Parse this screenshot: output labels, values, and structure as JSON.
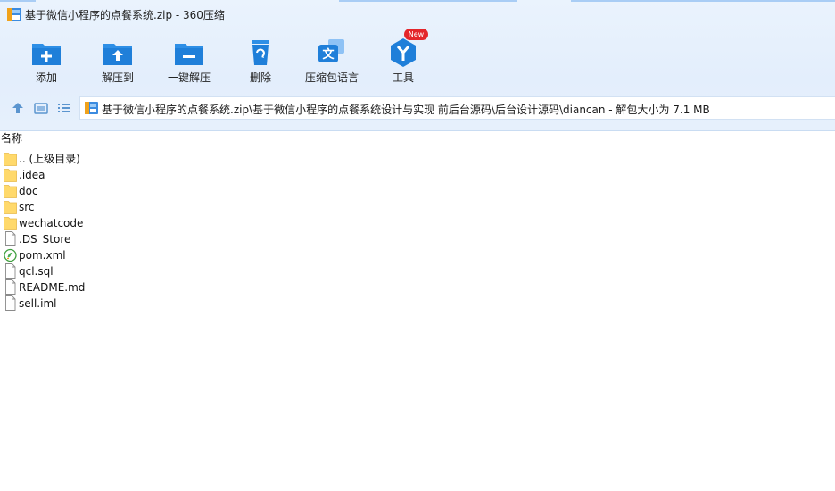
{
  "window": {
    "title": "基于微信小程序的点餐系统.zip - 360压缩"
  },
  "toolbar": {
    "items": [
      {
        "label": "添加",
        "icon": "add-icon"
      },
      {
        "label": "解压到",
        "icon": "extract-to-icon"
      },
      {
        "label": "一键解压",
        "icon": "one-click-extract-icon"
      },
      {
        "label": "删除",
        "icon": "delete-icon"
      },
      {
        "label": "压缩包语言",
        "icon": "archive-language-icon"
      },
      {
        "label": "工具",
        "icon": "tools-icon"
      }
    ],
    "new_badge": "New"
  },
  "nav": {
    "up_icon": "up-arrow-icon",
    "view_icon": "thumbnail-view-icon",
    "list_icon": "list-view-icon"
  },
  "address": {
    "path": "基于微信小程序的点餐系统.zip\\基于微信小程序的点餐系统设计与实现 前后台源码\\后台设计源码\\diancan - 解包大小为 7.1 MB"
  },
  "file_list": {
    "column_name": "名称",
    "entries": [
      {
        "name": ".. (上级目录)",
        "type": "folder"
      },
      {
        "name": ".idea",
        "type": "folder"
      },
      {
        "name": "doc",
        "type": "folder"
      },
      {
        "name": "src",
        "type": "folder"
      },
      {
        "name": "wechatcode",
        "type": "folder"
      },
      {
        "name": ".DS_Store",
        "type": "file"
      },
      {
        "name": "pom.xml",
        "type": "xml"
      },
      {
        "name": "qcl.sql",
        "type": "file"
      },
      {
        "name": "README.md",
        "type": "file"
      },
      {
        "name": "sell.iml",
        "type": "file"
      }
    ]
  },
  "colors": {
    "accent": "#1e88d8",
    "folder": "#ffd96b",
    "toolbar_bg": "#e6f0fc",
    "badge": "#e4262b"
  }
}
